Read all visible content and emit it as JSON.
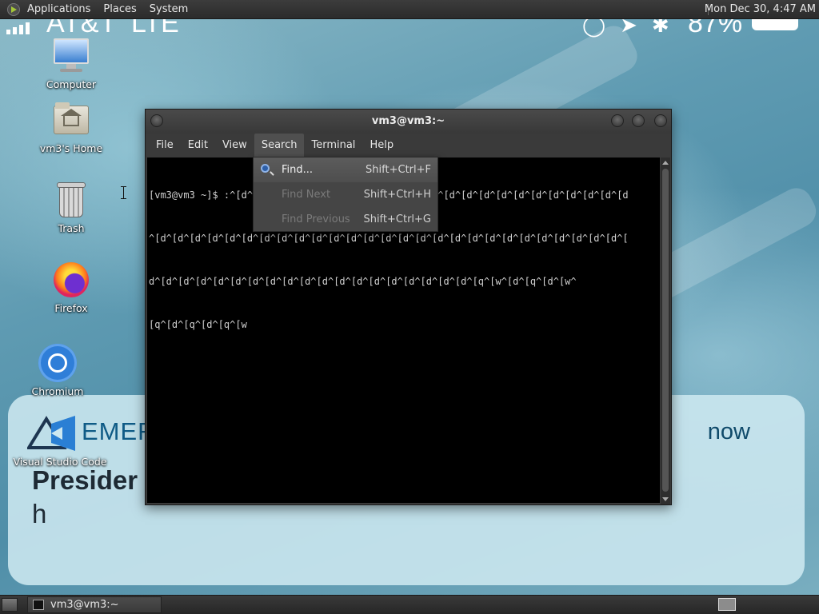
{
  "top_panel": {
    "menus": [
      "Applications",
      "Places",
      "System"
    ],
    "clock": "Mon Dec 30,  4:47 AM"
  },
  "phone_status": {
    "carrier": "AT&T",
    "network": "LTE",
    "battery": "87%"
  },
  "notification": {
    "brand": "EMER",
    "time": "now",
    "headline": "Presider",
    "body": "h"
  },
  "desktop_icons": {
    "computer": "Computer",
    "home": "vm3's Home",
    "trash": "Trash",
    "firefox": "Firefox",
    "chromium": "Chromium",
    "vscode": "Visual Studio Code"
  },
  "terminal": {
    "title": "vm3@vm3:~",
    "menus": [
      "File",
      "Edit",
      "View",
      "Search",
      "Terminal",
      "Help"
    ],
    "active_menu": "Search",
    "lines": [
      "[vm3@vm3 ~]$ :^[d^[d^[d^[d^[d^[d^[d^[d^[d^[d^[d^[d^[d^[d^[d^[d^[d^[d^[d^[d^[d^[d^[d",
      "^[d^[d^[d^[d^[d^[d^[d^[d^[d^[d^[d^[d^[d^[d^[d^[d^[d^[d^[d^[d^[d^[d^[d^[d^[d^[d^[d^[",
      "d^[d^[d^[d^[d^[d^[d^[d^[d^[d^[d^[d^[d^[d^[d^[d^[d^[d^[d^[q^[w^[d^[q^[d^[w^",
      "[q^[d^[q^[d^[q^[w"
    ]
  },
  "search_menu": {
    "items": [
      {
        "label": "Find...",
        "accel": "Shift+Ctrl+F",
        "enabled": true
      },
      {
        "label": "Find Next",
        "accel": "Shift+Ctrl+H",
        "enabled": false
      },
      {
        "label": "Find Previous",
        "accel": "Shift+Ctrl+G",
        "enabled": false
      }
    ]
  },
  "taskbar": {
    "window_label": "vm3@vm3:~"
  }
}
